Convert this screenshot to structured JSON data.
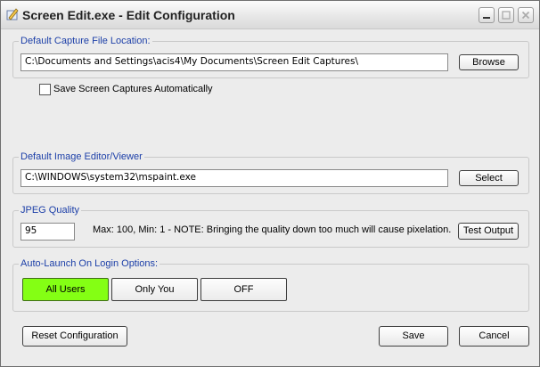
{
  "window": {
    "title": "Screen Edit.exe - Edit Configuration",
    "controls": {
      "minimize": "minimize",
      "maximize": "maximize",
      "close": "close"
    }
  },
  "capture": {
    "legend": "Default Capture File Location:",
    "path": "C:\\Documents and Settings\\acis4\\My Documents\\Screen Edit Captures\\",
    "browse_label": "Browse",
    "auto_save_label": "Save Screen Captures Automatically",
    "auto_save_checked": false
  },
  "editor": {
    "legend": "Default Image Editor/Viewer",
    "path": "C:\\WINDOWS\\system32\\mspaint.exe",
    "select_label": "Select"
  },
  "jpeg": {
    "legend": "JPEG Quality",
    "value": "95",
    "note": "Max: 100, Min: 1 - NOTE: Bringing the quality down too much will cause pixelation.",
    "test_label": "Test Output"
  },
  "autolaunch": {
    "legend": "Auto-Launch On Login Options:",
    "options": [
      "All Users",
      "Only You",
      "OFF"
    ],
    "selected": "All Users",
    "selected_color": "#84ff14"
  },
  "footer": {
    "reset_label": "Reset Configuration",
    "save_label": "Save",
    "cancel_label": "Cancel"
  }
}
